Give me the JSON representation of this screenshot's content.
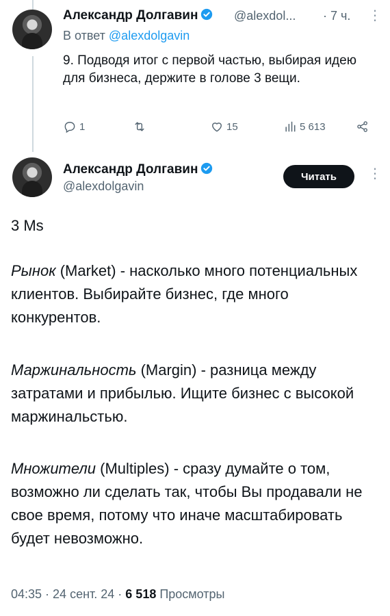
{
  "reply": {
    "name": "Александр Долгавин",
    "handle": "@alexdol...",
    "time": "· 7 ч.",
    "replying_prefix": "В ответ",
    "replying_handle": "@alexdolgavin",
    "text": "9. Подводя итог с первой частью, выбирая идею для бизнеса, держите в голове 3 вещи.",
    "replies": "1",
    "retweets": "",
    "likes": "15",
    "views": "5 613"
  },
  "tweet": {
    "name": "Александр Долгавин",
    "handle": "@alexdolgavin",
    "read_button": "Читать",
    "heading": "3 Ms",
    "p1_term": "Рынок",
    "p1_rest": " (Market) - насколько много потенциальных клиентов. Выбирайте бизнес, где много конкурентов.",
    "p2_term": "Маржинальность",
    "p2_rest": " (Margin) - разница между затратами и прибылью. Ищите бизнес с высокой маржинальстью.",
    "p3_term": "Множители",
    "p3_rest": " (Multiples) - сразу думайте о том, возможно ли сделать так, чтобы Вы продавали не свое время, потому что иначе масштабировать будет невозможно.",
    "meta_time": "04:35 · 24 сент. 24 · ",
    "meta_views": "6 518",
    "meta_views_label": " Просмотры"
  },
  "colors": {
    "accent": "#1d9bf0",
    "muted": "#536471",
    "button": "#0f1419"
  },
  "icons": [
    "verified-icon",
    "reply-icon",
    "retweet-icon",
    "like-icon",
    "views-icon",
    "share-icon",
    "more-icon"
  ]
}
